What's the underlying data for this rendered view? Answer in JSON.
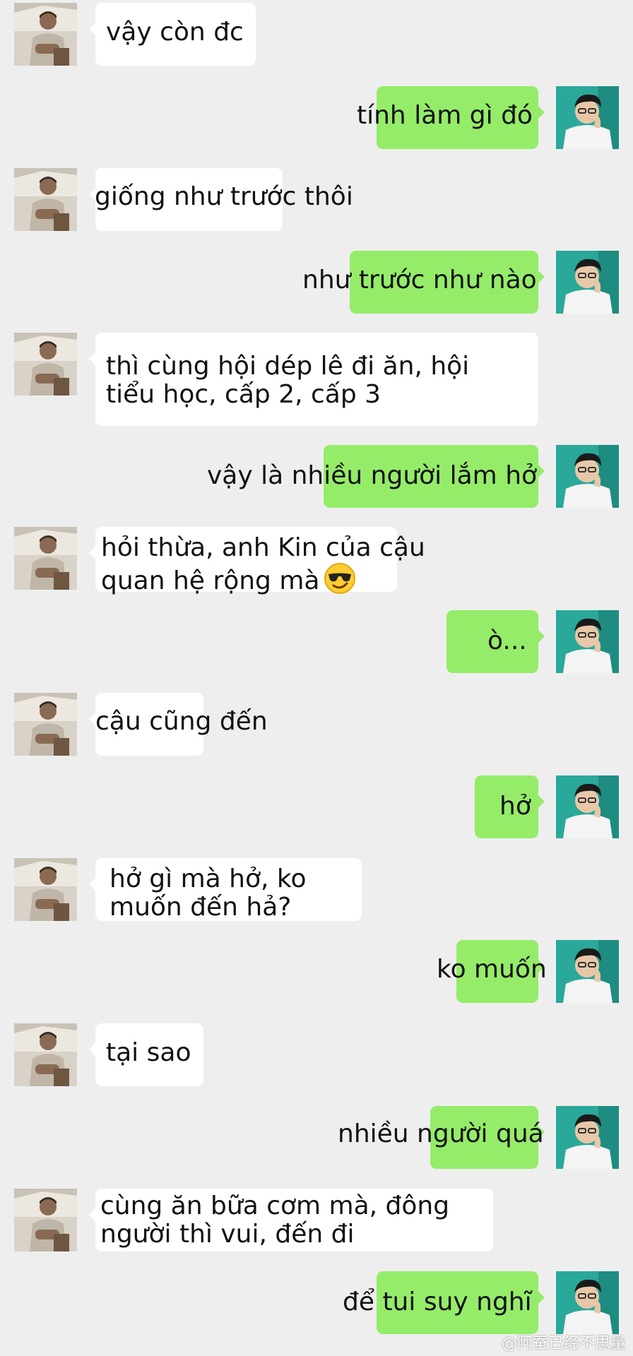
{
  "conversation": {
    "messages": [
      {
        "side": "left",
        "lines": [
          "vậy còn đc"
        ]
      },
      {
        "side": "right",
        "lines": [
          "tính làm gì đó"
        ]
      },
      {
        "side": "left",
        "lines": [
          "giống như trước thôi"
        ]
      },
      {
        "side": "right",
        "lines": [
          "như trước như nào"
        ]
      },
      {
        "side": "left",
        "lines": [
          "thì cùng hội dép lê đi ăn, hội",
          "tiểu học, cấp 2, cấp 3"
        ]
      },
      {
        "side": "right",
        "lines": [
          "vậy là nhiều người lắm hở"
        ]
      },
      {
        "side": "left",
        "lines": [
          "hỏi thừa, anh Kin của cậu",
          "quan hệ rộng mà"
        ],
        "emoji": "sunglasses-emoji"
      },
      {
        "side": "right",
        "lines": [
          "ò..."
        ]
      },
      {
        "side": "left",
        "lines": [
          "cậu cũng đến"
        ]
      },
      {
        "side": "right",
        "lines": [
          "hở"
        ]
      },
      {
        "side": "left",
        "lines": [
          "hở gì mà hở, ko",
          "muốn đến hả?"
        ]
      },
      {
        "side": "right",
        "lines": [
          "ko muốn"
        ]
      },
      {
        "side": "left",
        "lines": [
          "tại sao"
        ]
      },
      {
        "side": "right",
        "lines": [
          "nhiều người quá"
        ]
      },
      {
        "side": "left",
        "lines": [
          "cùng ăn bữa cơm mà, đông",
          "người thì vui, đến đi"
        ]
      },
      {
        "side": "right",
        "lines": [
          "để tui suy nghĩ"
        ]
      }
    ]
  },
  "watermark": {
    "text": "@阿蚕已经不思量"
  },
  "colors": {
    "background": "#eeeeee",
    "incoming_bubble": "#ffffff",
    "outgoing_bubble": "#95ec69",
    "text": "#111111"
  }
}
